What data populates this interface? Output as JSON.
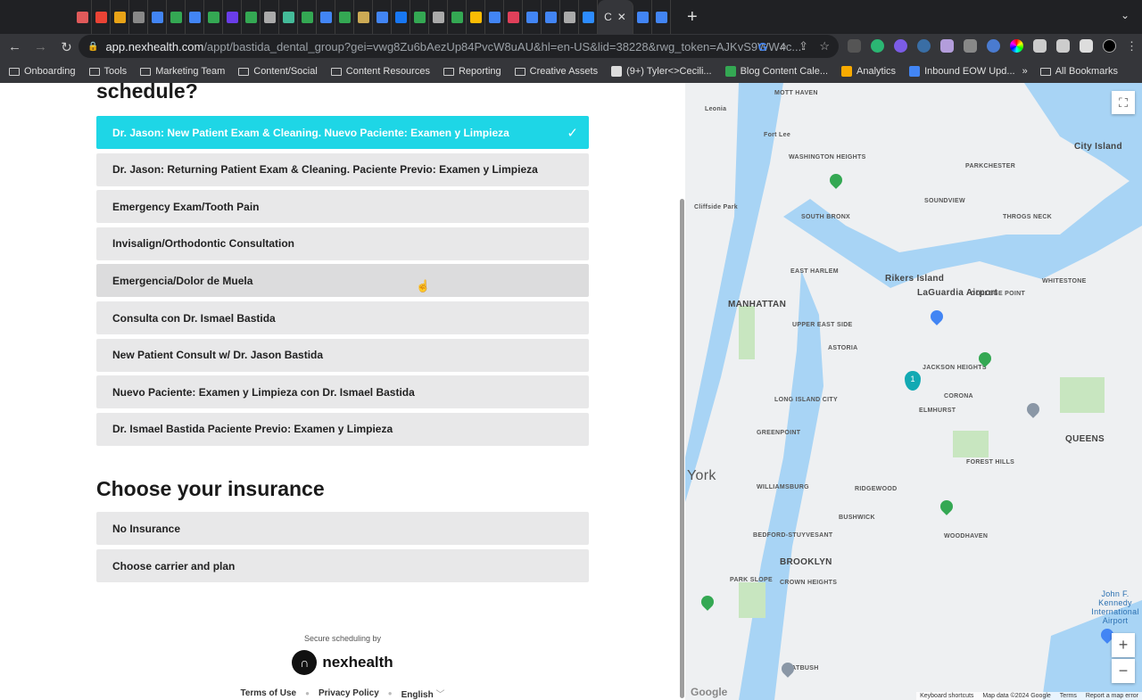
{
  "browser": {
    "active_tab_label": "C",
    "url_host": "app.nexhealth.com",
    "url_path": "/appt/bastida_dental_group?gei=vwg8Zu6bAezUp84PvcW8uAU&hl=en-US&lid=38228&rwg_token=AJKvS9WW4c...",
    "tab_colors": [
      "#e05a5a",
      "#ea4335",
      "#e8a317",
      "#888888",
      "#4285f4",
      "#34a853",
      "#4285f4",
      "#34a853",
      "#6a3de8",
      "#34a853",
      "#aaaaaa",
      "#44bb99",
      "#34a853",
      "#4285f4",
      "#34a853",
      "#ccaa55",
      "#4285f4",
      "#1877f2",
      "#34a853",
      "#aaaaaa",
      "#34a853",
      "#fbbc04",
      "#4285f4",
      "#e0405a",
      "#4285f4",
      "#4285f4",
      "#aaaaaa",
      "#2d8cff",
      "#4285f4",
      "#4285f4"
    ],
    "bookmarks": [
      "Onboarding",
      "Tools",
      "Marketing Team",
      "Content/Social",
      "Content Resources",
      "Reporting",
      "Creative Assets",
      "(9+) Tyler<>Cecili...",
      "Blog Content Cale...",
      "Analytics",
      "Inbound EOW Upd..."
    ],
    "all_bookmarks": "All Bookmarks"
  },
  "scheduler": {
    "heading": "schedule?",
    "options": [
      "Dr. Jason: New Patient Exam & Cleaning. Nuevo Paciente: Examen y Limpieza",
      "Dr. Jason: Returning Patient Exam & Cleaning. Paciente Previo: Examen y Limpieza",
      "Emergency Exam/Tooth Pain",
      "Invisalign/Orthodontic Consultation",
      "Emergencia/Dolor de Muela",
      "Consulta con Dr. Ismael Bastida",
      "New Patient Consult w/ Dr. Jason Bastida",
      "Nuevo Paciente: Examen y Limpieza con Dr. Ismael Bastida",
      "Dr. Ismael Bastida Paciente Previo: Examen y Limpieza"
    ],
    "selected_index": 0,
    "insurance_heading": "Choose your insurance",
    "insurance_options": [
      "No Insurance",
      "Choose carrier and plan"
    ],
    "accent_color": "#1ed6e6"
  },
  "footer": {
    "secure": "Secure scheduling by",
    "brand": "nexhealth",
    "terms": "Terms of Use",
    "privacy": "Privacy Policy",
    "language": "English"
  },
  "map": {
    "labels": [
      "Leonia",
      "Fort Lee",
      "City Island",
      "Cliffside Park",
      "MANHATTAN",
      "Rikers Island",
      "LaGuardia Airport",
      "ASTORIA",
      "JACKSON HEIGHTS",
      "QUEENS",
      "York",
      "BROOKLYN",
      "WILLIAMSBURG",
      "BUSHWICK",
      "RIDGEWOOD",
      "FOREST HILLS",
      "John F. Kennedy International Airport",
      "WASHINGTON HEIGHTS",
      "SOUTH BRONX",
      "EAST HARLEM",
      "UPPER EAST SIDE",
      "LONG ISLAND CITY",
      "GREENPOINT",
      "CORONA",
      "ELMHURST",
      "FLATBUSH",
      "CROWN HEIGHTS",
      "PARK SLOPE",
      "BEDFORD-STUYVESANT",
      "WOODHAVEN",
      "SOUNDVIEW",
      "THROGS NECK",
      "PARKCHESTER",
      "MOTT HAVEN",
      "COLLEGE POINT",
      "WHITESTONE"
    ],
    "marker_number": "1",
    "attribution": [
      "Keyboard shortcuts",
      "Map data ©2024 Google",
      "Terms",
      "Report a map error"
    ],
    "google": "Google",
    "zoom_in": "+",
    "zoom_out": "−"
  }
}
